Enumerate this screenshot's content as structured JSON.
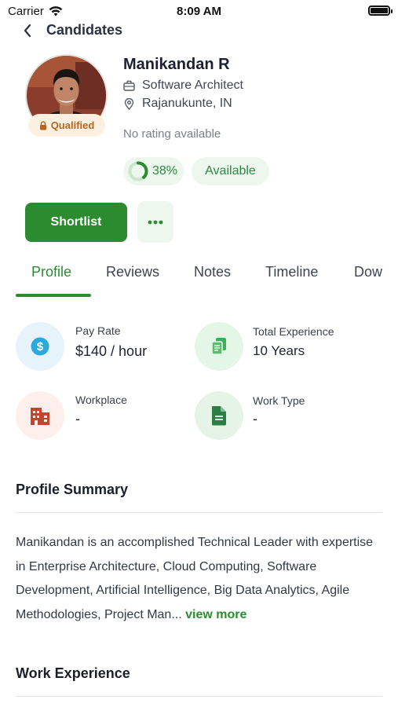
{
  "status_bar": {
    "carrier": "Carrier",
    "time": "8:09 AM"
  },
  "nav": {
    "title": "Candidates"
  },
  "candidate": {
    "name": "Manikandan R",
    "role": "Software Architect",
    "location": "Rajanukunte, IN",
    "rating_text": "No rating available",
    "badge": "Qualified",
    "match_percent": "38%",
    "match_progress": 0.38,
    "availability": "Available"
  },
  "actions": {
    "shortlist_label": "Shortlist"
  },
  "tabs": [
    "Profile",
    "Reviews",
    "Notes",
    "Timeline",
    "Dow"
  ],
  "stats": {
    "pay_rate": {
      "label": "Pay Rate",
      "value": "$140 / hour"
    },
    "experience": {
      "label": "Total Experience",
      "value": "10 Years"
    },
    "workplace": {
      "label": "Workplace",
      "value": "-"
    },
    "work_type": {
      "label": "Work Type",
      "value": "-"
    }
  },
  "profile_summary": {
    "title": "Profile Summary",
    "text": "Manikandan is an accomplished Technical Leader with expertise in Enterprise Architecture, Cloud Computing, Software Development, Artificial Intelligence, Big Data Analytics, Agile Methodologies, Project Man... ",
    "view_more": "view more"
  },
  "work_experience": {
    "title": "Work Experience"
  },
  "colors": {
    "accent_green": "#2a8c2e",
    "badge_orange": "#b5651d",
    "pay_icon_blue": "#29a9e0",
    "workplace_icon_red": "#c0472f",
    "experience_icon_green": "#3fae5a",
    "worktype_icon_green": "#2e7d44"
  }
}
